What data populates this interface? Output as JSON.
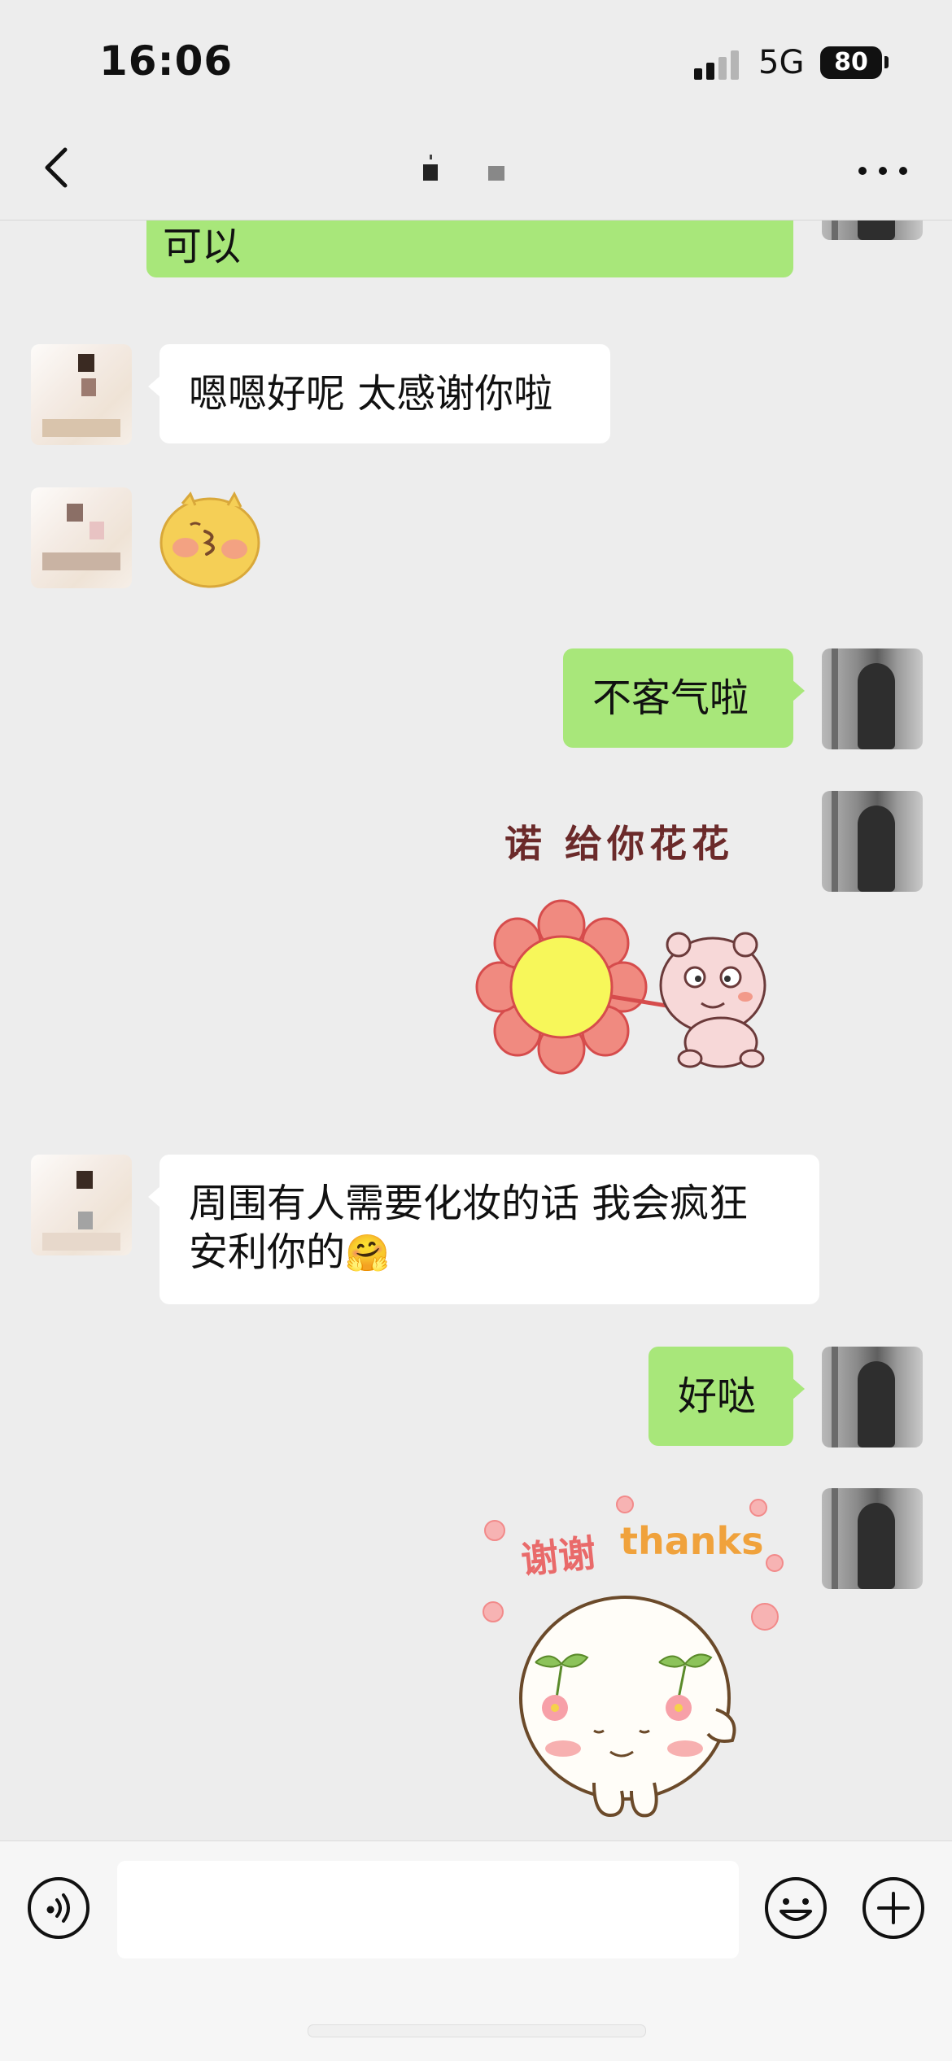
{
  "status": {
    "time": "16:06",
    "network": "5G",
    "battery": "80"
  },
  "header": {
    "title_blurred": true
  },
  "messages": [
    {
      "side": "out",
      "type": "text",
      "text": "可以"
    },
    {
      "side": "in",
      "type": "text",
      "text": "嗯嗯好呢 太感谢你啦"
    },
    {
      "side": "in",
      "type": "sticker",
      "sticker": "kiss-face-sticker"
    },
    {
      "side": "out",
      "type": "text",
      "text": "不客气啦"
    },
    {
      "side": "out",
      "type": "sticker",
      "sticker": "flower-bear-sticker",
      "label": "诺 给你花花"
    },
    {
      "side": "in",
      "type": "text",
      "line1": "周围有人需要化妆的话 我会疯狂",
      "line2": "安利你的",
      "emoji": "🤗"
    },
    {
      "side": "out",
      "type": "text",
      "text": "好哒"
    },
    {
      "side": "out",
      "type": "sticker",
      "sticker": "cherry-thanks-sticker",
      "label_cn": "谢谢",
      "label_en": "thanks"
    }
  ],
  "input": {
    "placeholder": "",
    "value": ""
  },
  "colors": {
    "background": "#ededed",
    "outgoing_bubble": "#a8e77a",
    "incoming_bubble": "#ffffff"
  }
}
